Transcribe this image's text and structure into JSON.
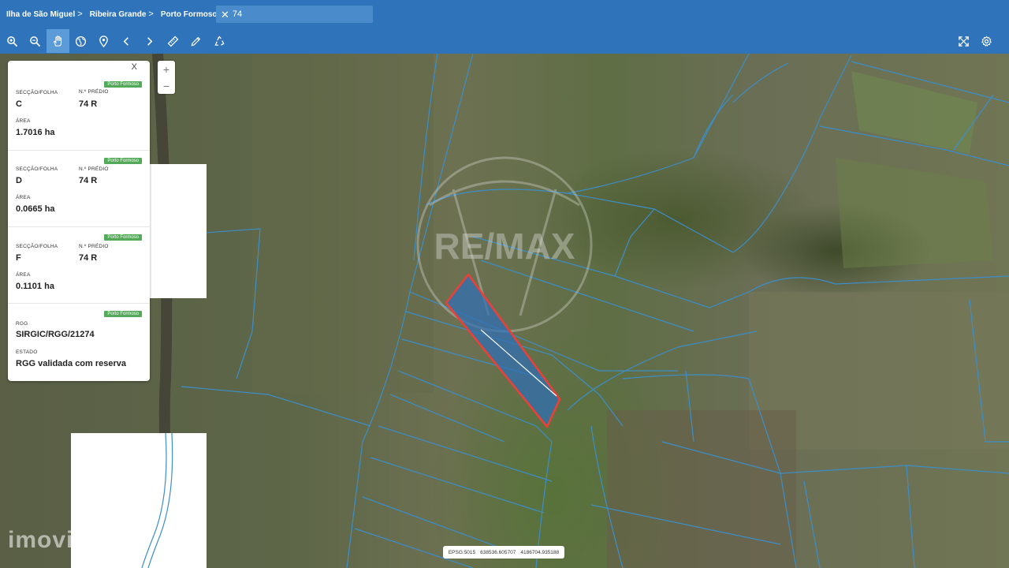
{
  "breadcrumb": [
    "Ilha de São Miguel",
    "Ribeira Grande",
    "Porto Formoso"
  ],
  "breadcrumb_separator": ">",
  "search": {
    "close_symbol": "✕",
    "value": "74"
  },
  "toolbar": {
    "active_tool": "pan-hand-icon",
    "tools": [
      "zoom-in-icon",
      "zoom-out-icon",
      "pan-hand-icon",
      "globe-icon",
      "location-pin-icon",
      "chevron-left-icon",
      "chevron-right-icon",
      "ruler-icon",
      "pencil-icon",
      "recycle-icon"
    ],
    "right_tools": [
      "fullscreen-icon",
      "gear-icon"
    ]
  },
  "map_controls": {
    "zoom_in": "+",
    "zoom_out": "−"
  },
  "info_panel": {
    "close_label": "X",
    "cards": [
      {
        "tag": "Porto Formoso",
        "sec_label": "SECÇÃO/FOLHA",
        "sec_value": "C",
        "predio_label": "N.º PRÉDIO",
        "predio_value": "74 R",
        "area_label": "ÁREA",
        "area_value": "1.7016 ha"
      },
      {
        "tag": "Porto Formoso",
        "sec_label": "SECÇÃO/FOLHA",
        "sec_value": "D",
        "predio_label": "N.º PRÉDIO",
        "predio_value": "74 R",
        "area_label": "ÁREA",
        "area_value": "0.0665 ha"
      },
      {
        "tag": "Porto Formoso",
        "sec_label": "SECÇÃO/FOLHA",
        "sec_value": "F",
        "predio_label": "N.º PRÉDIO",
        "predio_value": "74 R",
        "area_label": "ÁREA",
        "area_value": "0.1101 ha"
      }
    ],
    "rgg": {
      "tag": "Porto Formoso",
      "rgg_label": "RGG",
      "rgg_value": "SIRGIC/RGG/21274",
      "estado_label": "ESTADO",
      "estado_value": "RGG validada com reserva"
    }
  },
  "coordinates": {
    "epsg": "EPSG:5015",
    "x": "638536.605707",
    "y": "4186704.935188"
  },
  "watermarks": {
    "center": "RE/MAX",
    "bottom_left": "imovi"
  },
  "colors": {
    "header": "#2f74ba",
    "tag_green": "#55a95b",
    "parcel_lines": "#3d8ec8",
    "selected_outline": "#e8413a",
    "selected_fill": "#2f6fb5"
  }
}
